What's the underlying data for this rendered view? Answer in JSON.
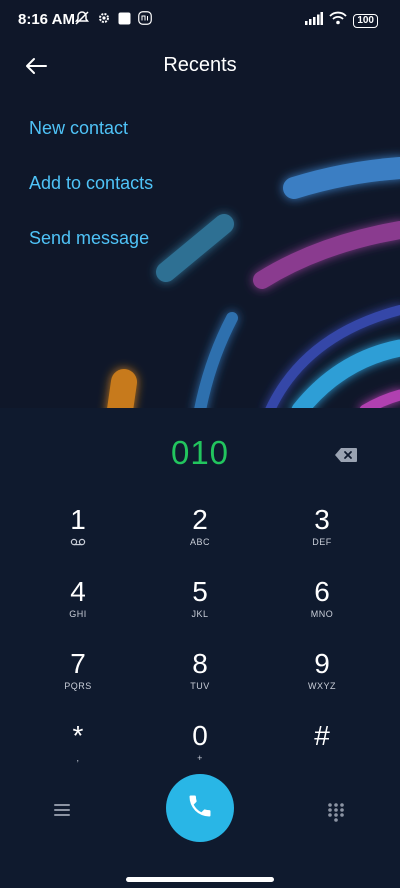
{
  "status_bar": {
    "time": "8:16 AM",
    "battery": "100",
    "icons": [
      "mute-icon",
      "settings-icon",
      "square-icon",
      "mi-icon",
      "signal-icon",
      "wifi-icon",
      "battery-icon"
    ]
  },
  "header": {
    "title": "Recents",
    "back_icon": "back-arrow-icon"
  },
  "menu": {
    "items": [
      {
        "label": "New contact"
      },
      {
        "label": "Add to contacts"
      },
      {
        "label": "Send message"
      }
    ]
  },
  "dialer": {
    "number": "010",
    "backspace_icon": "backspace-icon",
    "keys": [
      {
        "digit": "1",
        "letters": "voicemail"
      },
      {
        "digit": "2",
        "letters": "ABC"
      },
      {
        "digit": "3",
        "letters": "DEF"
      },
      {
        "digit": "4",
        "letters": "GHI"
      },
      {
        "digit": "5",
        "letters": "JKL"
      },
      {
        "digit": "6",
        "letters": "MNO"
      },
      {
        "digit": "7",
        "letters": "PQRS"
      },
      {
        "digit": "8",
        "letters": "TUV"
      },
      {
        "digit": "9",
        "letters": "WXYZ"
      },
      {
        "digit": "*",
        "letters": ","
      },
      {
        "digit": "0",
        "letters": "+"
      },
      {
        "digit": "#",
        "letters": ""
      }
    ]
  },
  "bottom_bar": {
    "menu_icon": "hamburger-menu-icon",
    "call_icon": "phone-icon",
    "dialpad_icon": "dialpad-icon"
  },
  "colors": {
    "background": "#0f1729",
    "accent": "#4fc3f7",
    "number": "#22c55e",
    "call_button": "#29b6e6"
  }
}
